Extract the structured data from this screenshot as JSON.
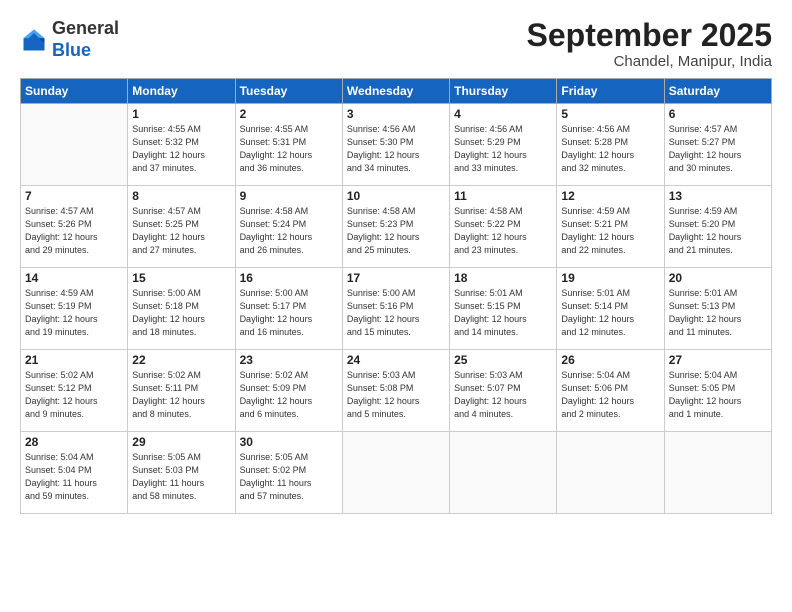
{
  "logo": {
    "general": "General",
    "blue": "Blue"
  },
  "header": {
    "month": "September 2025",
    "location": "Chandel, Manipur, India"
  },
  "weekdays": [
    "Sunday",
    "Monday",
    "Tuesday",
    "Wednesday",
    "Thursday",
    "Friday",
    "Saturday"
  ],
  "weeks": [
    [
      {
        "day": "",
        "text": ""
      },
      {
        "day": "1",
        "text": "Sunrise: 4:55 AM\nSunset: 5:32 PM\nDaylight: 12 hours\nand 37 minutes."
      },
      {
        "day": "2",
        "text": "Sunrise: 4:55 AM\nSunset: 5:31 PM\nDaylight: 12 hours\nand 36 minutes."
      },
      {
        "day": "3",
        "text": "Sunrise: 4:56 AM\nSunset: 5:30 PM\nDaylight: 12 hours\nand 34 minutes."
      },
      {
        "day": "4",
        "text": "Sunrise: 4:56 AM\nSunset: 5:29 PM\nDaylight: 12 hours\nand 33 minutes."
      },
      {
        "day": "5",
        "text": "Sunrise: 4:56 AM\nSunset: 5:28 PM\nDaylight: 12 hours\nand 32 minutes."
      },
      {
        "day": "6",
        "text": "Sunrise: 4:57 AM\nSunset: 5:27 PM\nDaylight: 12 hours\nand 30 minutes."
      }
    ],
    [
      {
        "day": "7",
        "text": "Sunrise: 4:57 AM\nSunset: 5:26 PM\nDaylight: 12 hours\nand 29 minutes."
      },
      {
        "day": "8",
        "text": "Sunrise: 4:57 AM\nSunset: 5:25 PM\nDaylight: 12 hours\nand 27 minutes."
      },
      {
        "day": "9",
        "text": "Sunrise: 4:58 AM\nSunset: 5:24 PM\nDaylight: 12 hours\nand 26 minutes."
      },
      {
        "day": "10",
        "text": "Sunrise: 4:58 AM\nSunset: 5:23 PM\nDaylight: 12 hours\nand 25 minutes."
      },
      {
        "day": "11",
        "text": "Sunrise: 4:58 AM\nSunset: 5:22 PM\nDaylight: 12 hours\nand 23 minutes."
      },
      {
        "day": "12",
        "text": "Sunrise: 4:59 AM\nSunset: 5:21 PM\nDaylight: 12 hours\nand 22 minutes."
      },
      {
        "day": "13",
        "text": "Sunrise: 4:59 AM\nSunset: 5:20 PM\nDaylight: 12 hours\nand 21 minutes."
      }
    ],
    [
      {
        "day": "14",
        "text": "Sunrise: 4:59 AM\nSunset: 5:19 PM\nDaylight: 12 hours\nand 19 minutes."
      },
      {
        "day": "15",
        "text": "Sunrise: 5:00 AM\nSunset: 5:18 PM\nDaylight: 12 hours\nand 18 minutes."
      },
      {
        "day": "16",
        "text": "Sunrise: 5:00 AM\nSunset: 5:17 PM\nDaylight: 12 hours\nand 16 minutes."
      },
      {
        "day": "17",
        "text": "Sunrise: 5:00 AM\nSunset: 5:16 PM\nDaylight: 12 hours\nand 15 minutes."
      },
      {
        "day": "18",
        "text": "Sunrise: 5:01 AM\nSunset: 5:15 PM\nDaylight: 12 hours\nand 14 minutes."
      },
      {
        "day": "19",
        "text": "Sunrise: 5:01 AM\nSunset: 5:14 PM\nDaylight: 12 hours\nand 12 minutes."
      },
      {
        "day": "20",
        "text": "Sunrise: 5:01 AM\nSunset: 5:13 PM\nDaylight: 12 hours\nand 11 minutes."
      }
    ],
    [
      {
        "day": "21",
        "text": "Sunrise: 5:02 AM\nSunset: 5:12 PM\nDaylight: 12 hours\nand 9 minutes."
      },
      {
        "day": "22",
        "text": "Sunrise: 5:02 AM\nSunset: 5:11 PM\nDaylight: 12 hours\nand 8 minutes."
      },
      {
        "day": "23",
        "text": "Sunrise: 5:02 AM\nSunset: 5:09 PM\nDaylight: 12 hours\nand 6 minutes."
      },
      {
        "day": "24",
        "text": "Sunrise: 5:03 AM\nSunset: 5:08 PM\nDaylight: 12 hours\nand 5 minutes."
      },
      {
        "day": "25",
        "text": "Sunrise: 5:03 AM\nSunset: 5:07 PM\nDaylight: 12 hours\nand 4 minutes."
      },
      {
        "day": "26",
        "text": "Sunrise: 5:04 AM\nSunset: 5:06 PM\nDaylight: 12 hours\nand 2 minutes."
      },
      {
        "day": "27",
        "text": "Sunrise: 5:04 AM\nSunset: 5:05 PM\nDaylight: 12 hours\nand 1 minute."
      }
    ],
    [
      {
        "day": "28",
        "text": "Sunrise: 5:04 AM\nSunset: 5:04 PM\nDaylight: 11 hours\nand 59 minutes."
      },
      {
        "day": "29",
        "text": "Sunrise: 5:05 AM\nSunset: 5:03 PM\nDaylight: 11 hours\nand 58 minutes."
      },
      {
        "day": "30",
        "text": "Sunrise: 5:05 AM\nSunset: 5:02 PM\nDaylight: 11 hours\nand 57 minutes."
      },
      {
        "day": "",
        "text": ""
      },
      {
        "day": "",
        "text": ""
      },
      {
        "day": "",
        "text": ""
      },
      {
        "day": "",
        "text": ""
      }
    ]
  ]
}
